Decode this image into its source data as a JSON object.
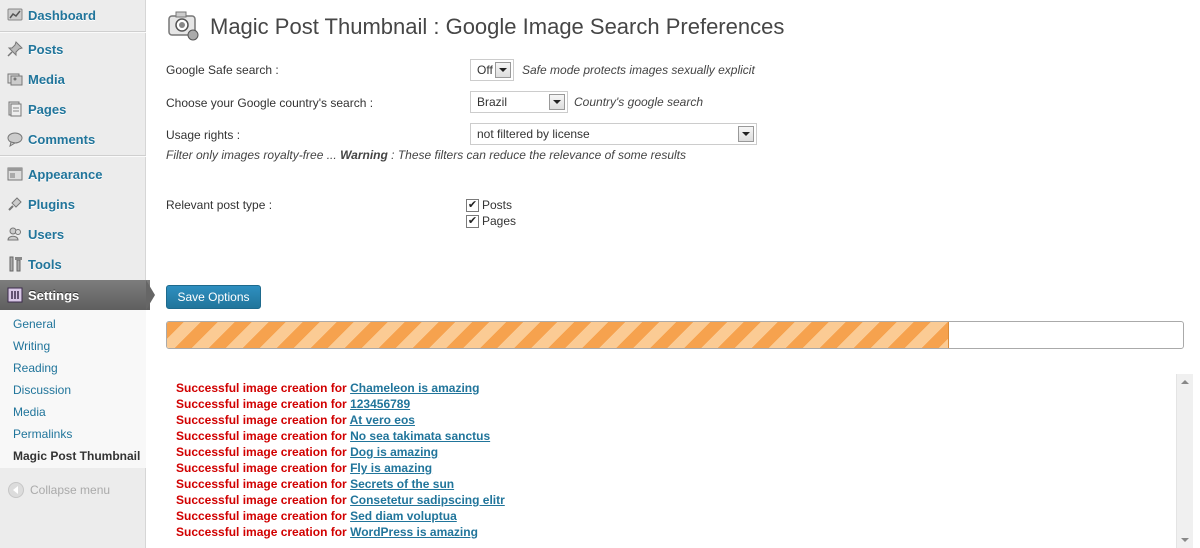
{
  "sidebar": {
    "items": [
      {
        "label": "Dashboard",
        "icon": "dashboard-icon"
      },
      {
        "label": "Posts",
        "icon": "pushpin-icon"
      },
      {
        "label": "Media",
        "icon": "media-icon"
      },
      {
        "label": "Pages",
        "icon": "pages-icon"
      },
      {
        "label": "Comments",
        "icon": "comment-bubble-icon"
      },
      {
        "label": "Appearance",
        "icon": "appearance-icon"
      },
      {
        "label": "Plugins",
        "icon": "plug-icon"
      },
      {
        "label": "Users",
        "icon": "users-icon"
      },
      {
        "label": "Tools",
        "icon": "tools-icon"
      },
      {
        "label": "Settings",
        "icon": "settings-icon"
      }
    ],
    "submenu": [
      "General",
      "Writing",
      "Reading",
      "Discussion",
      "Media",
      "Permalinks",
      "Magic Post Thumbnail"
    ],
    "current_submenu": "Magic Post Thumbnail",
    "collapse_label": "Collapse menu"
  },
  "page": {
    "title": "Magic Post Thumbnail : Google Image Search Preferences",
    "safe_search": {
      "label": "Google Safe search :",
      "value": "Off",
      "hint": "Safe mode protects images sexually explicit"
    },
    "country": {
      "label": "Choose your Google country's search :",
      "value": "Brazil",
      "hint": "Country's google search"
    },
    "usage_rights": {
      "label": "Usage rights :",
      "value": "not filtered by license",
      "note_prefix": "Filter only images royalty-free ... ",
      "note_warning": "Warning",
      "note_suffix": " : These filters can reduce the relevance of some results"
    },
    "post_type": {
      "label": "Relevant post type :",
      "options": [
        {
          "label": "Posts",
          "checked": true
        },
        {
          "label": "Pages",
          "checked": true
        }
      ]
    },
    "save_label": "Save Options",
    "progress_fraction": 0.77
  },
  "log": {
    "prefix": "Successful image creation for",
    "entries": [
      "Chameleon is amazing",
      "123456789",
      "At vero eos",
      "No sea takimata sanctus",
      "Dog is amazing",
      "Fly is amazing",
      "Secrets of the sun",
      "Consetetur sadipscing elitr",
      "Sed diam voluptua",
      "WordPress is amazing"
    ]
  },
  "colors": {
    "link": "#21759b",
    "success_prefix": "#d10000",
    "progress_stripe_a": "#f6a24e",
    "progress_stripe_b": "#fbcb94",
    "button": "#21759b"
  }
}
